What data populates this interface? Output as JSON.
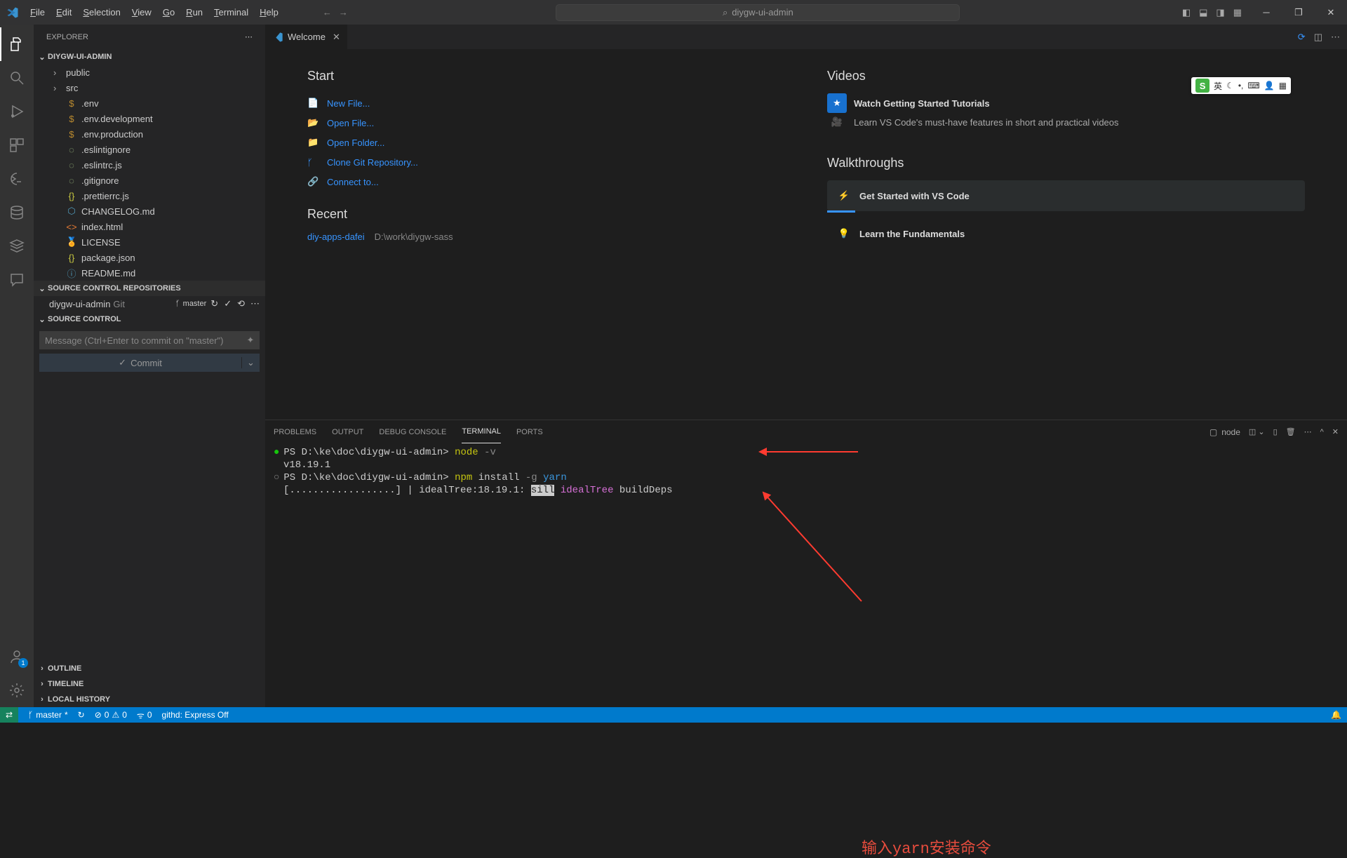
{
  "title_bar": {
    "menus": [
      "File",
      "Edit",
      "Selection",
      "View",
      "Go",
      "Run",
      "Terminal",
      "Help"
    ],
    "search_text": "diygw-ui-admin"
  },
  "activity_names": [
    "explorer",
    "search",
    "run-debug",
    "extensions",
    "remote-explorer",
    "testing",
    "docker",
    "accounts",
    "manage"
  ],
  "sidebar": {
    "title": "EXPLORER",
    "project": "DIYGW-UI-ADMIN",
    "tree": [
      {
        "kind": "folder",
        "name": "public"
      },
      {
        "kind": "folder",
        "name": "src"
      },
      {
        "kind": "file",
        "icon": "$",
        "cls": "c-dollar",
        "name": ".env"
      },
      {
        "kind": "file",
        "icon": "$",
        "cls": "c-dollar",
        "name": ".env.development"
      },
      {
        "kind": "file",
        "icon": "$",
        "cls": "c-dollar",
        "name": ".env.production"
      },
      {
        "kind": "file",
        "icon": "◌",
        "cls": "c-green",
        "name": ".eslintignore"
      },
      {
        "kind": "file",
        "icon": "◌",
        "cls": "c-green",
        "name": ".eslintrc.js"
      },
      {
        "kind": "file",
        "icon": "◌",
        "cls": "c-green",
        "name": ".gitignore"
      },
      {
        "kind": "file",
        "icon": "{}",
        "cls": "c-json",
        "name": ".prettierrc.js"
      },
      {
        "kind": "file",
        "icon": "⬡",
        "cls": "c-md",
        "name": "CHANGELOG.md"
      },
      {
        "kind": "file",
        "icon": "<>",
        "cls": "c-html",
        "name": "index.html"
      },
      {
        "kind": "file",
        "icon": "🏅",
        "cls": "c-lic",
        "name": "LICENSE"
      },
      {
        "kind": "file",
        "icon": "{}",
        "cls": "c-json",
        "name": "package.json"
      },
      {
        "kind": "file",
        "icon": "ⓘ",
        "cls": "c-md",
        "name": "README.md"
      }
    ],
    "scm_repos_header": "SOURCE CONTROL REPOSITORIES",
    "scm_repo": {
      "name": "diygw-ui-admin",
      "kind": "Git",
      "branch": "master"
    },
    "scm_header": "SOURCE CONTROL",
    "commit_placeholder": "Message (Ctrl+Enter to commit on \"master\")",
    "commit_btn": "Commit",
    "outline": "OUTLINE",
    "timeline": "TIMELINE",
    "local_history": "LOCAL HISTORY"
  },
  "tab": {
    "label": "Welcome"
  },
  "welcome": {
    "start": "Start",
    "links": [
      "New File...",
      "Open File...",
      "Open Folder...",
      "Clone Git Repository...",
      "Connect to..."
    ],
    "recent": "Recent",
    "recent_item": {
      "name": "diy-apps-dafei",
      "path": "D:\\work\\diygw-sass"
    },
    "videos": "Videos",
    "video_title": "Watch Getting Started Tutorials",
    "video_desc": "Learn VS Code's must-have features in short and practical videos",
    "walkthroughs": "Walkthroughs",
    "walk1": "Get Started with VS Code",
    "walk2": "Learn the Fundamentals"
  },
  "panel": {
    "tabs": [
      "PROBLEMS",
      "OUTPUT",
      "DEBUG CONSOLE",
      "TERMINAL",
      "PORTS"
    ],
    "active": 3,
    "shell": "node"
  },
  "terminal": {
    "line1_prompt": "PS D:\\ke\\doc\\diygw-ui-admin>",
    "line1_cmd": "node",
    "line1_flag": "-v",
    "line2": "v18.19.1",
    "line3_prompt": "PS D:\\ke\\doc\\diygw-ui-admin>",
    "line3_cmd": "npm",
    "line3_arg1": "install",
    "line3_flag": "-g",
    "line3_arg2": "yarn",
    "line4_prefix": "[..................] | idealTree:18.19.1: ",
    "line4_tag": "sill",
    "line4_mid": "idealTree",
    "line4_end": "buildDeps"
  },
  "annotation": "输入yarn安装命令",
  "status": {
    "branch": "master",
    "sync": "↻",
    "errors": "0",
    "warnings": "0",
    "ports": "0",
    "githd": "githd: Express Off"
  },
  "ime": {
    "label": "英"
  }
}
